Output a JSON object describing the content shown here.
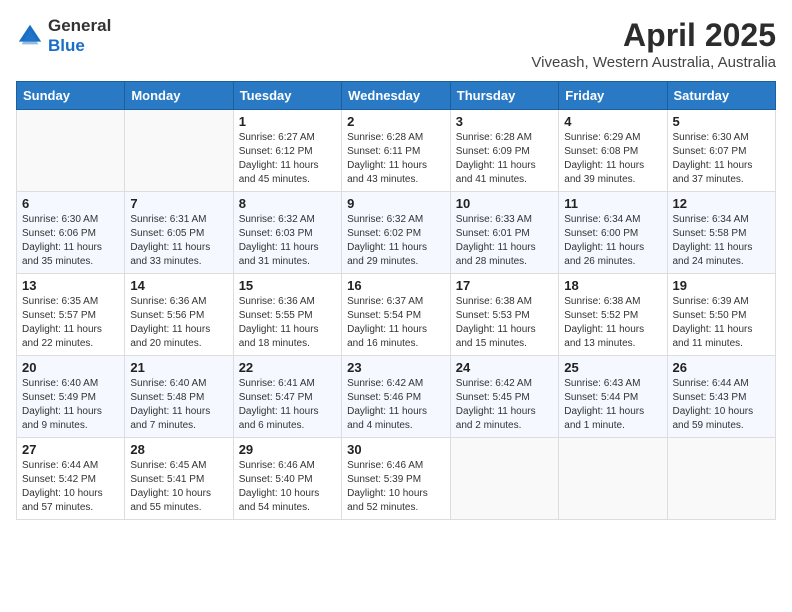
{
  "logo": {
    "general": "General",
    "blue": "Blue"
  },
  "title": "April 2025",
  "subtitle": "Viveash, Western Australia, Australia",
  "days_of_week": [
    "Sunday",
    "Monday",
    "Tuesday",
    "Wednesday",
    "Thursday",
    "Friday",
    "Saturday"
  ],
  "weeks": [
    [
      {
        "day": "",
        "info": ""
      },
      {
        "day": "",
        "info": ""
      },
      {
        "day": "1",
        "info": "Sunrise: 6:27 AM\nSunset: 6:12 PM\nDaylight: 11 hours and 45 minutes."
      },
      {
        "day": "2",
        "info": "Sunrise: 6:28 AM\nSunset: 6:11 PM\nDaylight: 11 hours and 43 minutes."
      },
      {
        "day": "3",
        "info": "Sunrise: 6:28 AM\nSunset: 6:09 PM\nDaylight: 11 hours and 41 minutes."
      },
      {
        "day": "4",
        "info": "Sunrise: 6:29 AM\nSunset: 6:08 PM\nDaylight: 11 hours and 39 minutes."
      },
      {
        "day": "5",
        "info": "Sunrise: 6:30 AM\nSunset: 6:07 PM\nDaylight: 11 hours and 37 minutes."
      }
    ],
    [
      {
        "day": "6",
        "info": "Sunrise: 6:30 AM\nSunset: 6:06 PM\nDaylight: 11 hours and 35 minutes."
      },
      {
        "day": "7",
        "info": "Sunrise: 6:31 AM\nSunset: 6:05 PM\nDaylight: 11 hours and 33 minutes."
      },
      {
        "day": "8",
        "info": "Sunrise: 6:32 AM\nSunset: 6:03 PM\nDaylight: 11 hours and 31 minutes."
      },
      {
        "day": "9",
        "info": "Sunrise: 6:32 AM\nSunset: 6:02 PM\nDaylight: 11 hours and 29 minutes."
      },
      {
        "day": "10",
        "info": "Sunrise: 6:33 AM\nSunset: 6:01 PM\nDaylight: 11 hours and 28 minutes."
      },
      {
        "day": "11",
        "info": "Sunrise: 6:34 AM\nSunset: 6:00 PM\nDaylight: 11 hours and 26 minutes."
      },
      {
        "day": "12",
        "info": "Sunrise: 6:34 AM\nSunset: 5:58 PM\nDaylight: 11 hours and 24 minutes."
      }
    ],
    [
      {
        "day": "13",
        "info": "Sunrise: 6:35 AM\nSunset: 5:57 PM\nDaylight: 11 hours and 22 minutes."
      },
      {
        "day": "14",
        "info": "Sunrise: 6:36 AM\nSunset: 5:56 PM\nDaylight: 11 hours and 20 minutes."
      },
      {
        "day": "15",
        "info": "Sunrise: 6:36 AM\nSunset: 5:55 PM\nDaylight: 11 hours and 18 minutes."
      },
      {
        "day": "16",
        "info": "Sunrise: 6:37 AM\nSunset: 5:54 PM\nDaylight: 11 hours and 16 minutes."
      },
      {
        "day": "17",
        "info": "Sunrise: 6:38 AM\nSunset: 5:53 PM\nDaylight: 11 hours and 15 minutes."
      },
      {
        "day": "18",
        "info": "Sunrise: 6:38 AM\nSunset: 5:52 PM\nDaylight: 11 hours and 13 minutes."
      },
      {
        "day": "19",
        "info": "Sunrise: 6:39 AM\nSunset: 5:50 PM\nDaylight: 11 hours and 11 minutes."
      }
    ],
    [
      {
        "day": "20",
        "info": "Sunrise: 6:40 AM\nSunset: 5:49 PM\nDaylight: 11 hours and 9 minutes."
      },
      {
        "day": "21",
        "info": "Sunrise: 6:40 AM\nSunset: 5:48 PM\nDaylight: 11 hours and 7 minutes."
      },
      {
        "day": "22",
        "info": "Sunrise: 6:41 AM\nSunset: 5:47 PM\nDaylight: 11 hours and 6 minutes."
      },
      {
        "day": "23",
        "info": "Sunrise: 6:42 AM\nSunset: 5:46 PM\nDaylight: 11 hours and 4 minutes."
      },
      {
        "day": "24",
        "info": "Sunrise: 6:42 AM\nSunset: 5:45 PM\nDaylight: 11 hours and 2 minutes."
      },
      {
        "day": "25",
        "info": "Sunrise: 6:43 AM\nSunset: 5:44 PM\nDaylight: 11 hours and 1 minute."
      },
      {
        "day": "26",
        "info": "Sunrise: 6:44 AM\nSunset: 5:43 PM\nDaylight: 10 hours and 59 minutes."
      }
    ],
    [
      {
        "day": "27",
        "info": "Sunrise: 6:44 AM\nSunset: 5:42 PM\nDaylight: 10 hours and 57 minutes."
      },
      {
        "day": "28",
        "info": "Sunrise: 6:45 AM\nSunset: 5:41 PM\nDaylight: 10 hours and 55 minutes."
      },
      {
        "day": "29",
        "info": "Sunrise: 6:46 AM\nSunset: 5:40 PM\nDaylight: 10 hours and 54 minutes."
      },
      {
        "day": "30",
        "info": "Sunrise: 6:46 AM\nSunset: 5:39 PM\nDaylight: 10 hours and 52 minutes."
      },
      {
        "day": "",
        "info": ""
      },
      {
        "day": "",
        "info": ""
      },
      {
        "day": "",
        "info": ""
      }
    ]
  ]
}
